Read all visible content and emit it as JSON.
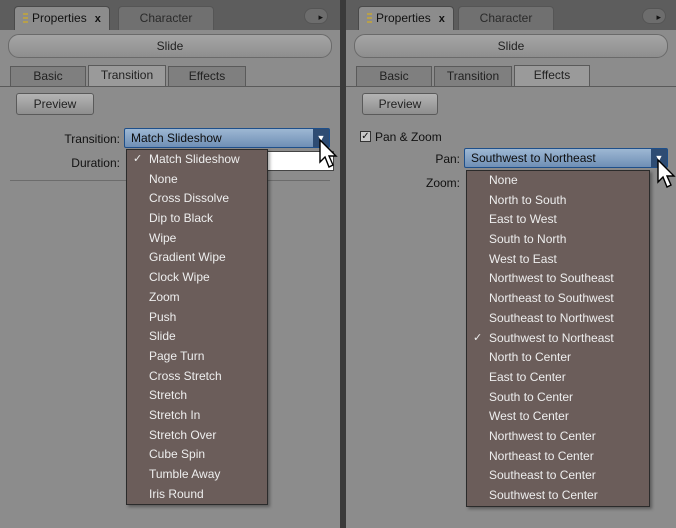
{
  "panels": {
    "left": {
      "tabs": {
        "properties": "Properties",
        "character": "Character"
      },
      "header": "Slide",
      "subtabs": {
        "basic": "Basic",
        "transition": "Transition",
        "effects": "Effects"
      },
      "preview_label": "Preview",
      "transition": {
        "label": "Transition:",
        "value": "Match Slideshow",
        "duration_label": "Duration:",
        "options": [
          "Match Slideshow",
          "None",
          "Cross Dissolve",
          "Dip to Black",
          "Wipe",
          "Gradient Wipe",
          "Clock Wipe",
          "Zoom",
          "Push",
          "Slide",
          "Page Turn",
          "Cross Stretch",
          "Stretch",
          "Stretch In",
          "Stretch Over",
          "Cube Spin",
          "Tumble Away",
          "Iris Round"
        ],
        "checked_index": 0
      }
    },
    "right": {
      "tabs": {
        "properties": "Properties",
        "character": "Character"
      },
      "header": "Slide",
      "subtabs": {
        "basic": "Basic",
        "transition": "Transition",
        "effects": "Effects"
      },
      "preview_label": "Preview",
      "pan_zoom": {
        "checkbox_label": "Pan & Zoom",
        "checked": true,
        "pan_label": "Pan:",
        "pan_value": "Southwest to Northeast",
        "zoom_label": "Zoom:",
        "options": [
          "None",
          "North to South",
          "East to West",
          "South to North",
          "West to East",
          "Northwest to Southeast",
          "Northeast to Southwest",
          "Southeast to Northwest",
          "Southwest to Northeast",
          "North to Center",
          "East to Center",
          "South to Center",
          "West to Center",
          "Northwest to Center",
          "Northeast to Center",
          "Southeast to Center",
          "Southwest to Center"
        ],
        "checked_index": 8
      }
    }
  },
  "glyphs": {
    "close": "x",
    "checkmark": "✓",
    "dropdown_arrow": "▼",
    "panel_menu": "▸"
  }
}
